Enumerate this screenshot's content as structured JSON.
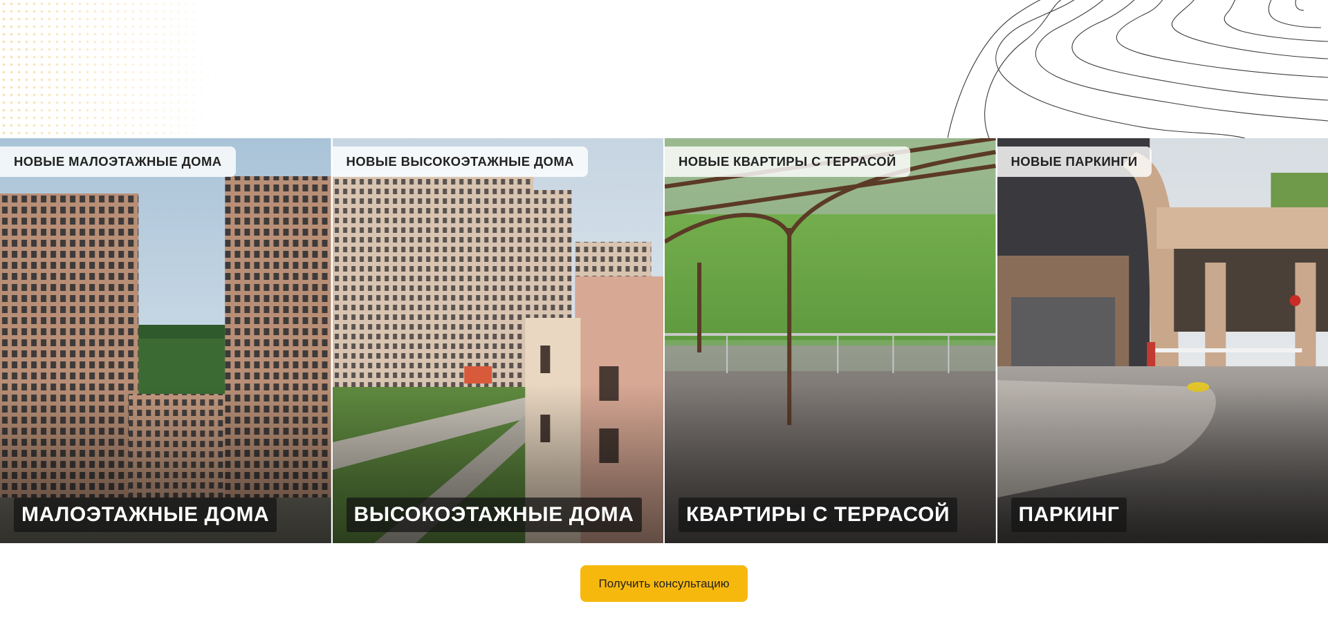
{
  "categories": [
    {
      "tag": "НОВЫЕ МАЛОЭТАЖНЫЕ ДОМА",
      "title": "МАЛОЭТАЖНЫЕ ДОМА"
    },
    {
      "tag": "НОВЫЕ ВЫСОКОЭТАЖНЫЕ ДОМА",
      "title": "ВЫСОКОЭТАЖНЫЕ ДОМА"
    },
    {
      "tag": "НОВЫЕ КВАРТИРЫ С ТЕРРАСОЙ",
      "title": "КВАРТИРЫ С ТЕРРАСОЙ"
    },
    {
      "tag": "НОВЫЕ ПАРКИНГИ",
      "title": "ПАРКИНГ"
    }
  ],
  "cta": {
    "label": "Получить консультацию"
  },
  "colors": {
    "accent": "#f7b80e",
    "dots": "#f3c867",
    "tag_bg": "#ffffff",
    "title_bg": "#141414"
  }
}
